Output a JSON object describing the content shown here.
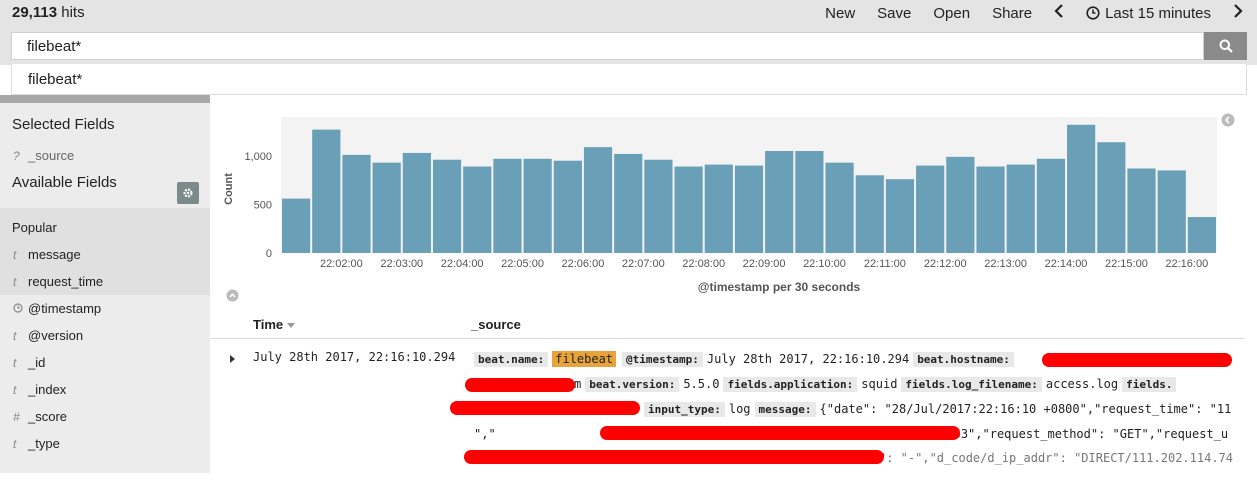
{
  "topbar": {
    "hits_count": "29,113",
    "hits_label": "hits",
    "menu": [
      "New",
      "Save",
      "Open",
      "Share"
    ],
    "time_range": "Last 15 minutes"
  },
  "search": {
    "query": "filebeat*",
    "suggestion": "filebeat*"
  },
  "sidebar": {
    "selected_title": "Selected Fields",
    "selected_fields": [
      {
        "type": "?",
        "name": "_source"
      }
    ],
    "available_title": "Available Fields",
    "popular_label": "Popular",
    "popular_fields": [
      {
        "type": "t",
        "name": "message"
      },
      {
        "type": "t",
        "name": "request_time"
      }
    ],
    "other_fields": [
      {
        "type": "clock",
        "name": "@timestamp"
      },
      {
        "type": "t",
        "name": "@version"
      },
      {
        "type": "t",
        "name": "_id"
      },
      {
        "type": "t",
        "name": "_index"
      },
      {
        "type": "#",
        "name": "_score"
      },
      {
        "type": "t",
        "name": "_type"
      }
    ]
  },
  "chart_data": {
    "type": "bar",
    "title": "",
    "xlabel": "@timestamp per 30 seconds",
    "ylabel": "Count",
    "ylim": [
      0,
      1400
    ],
    "yticks": [
      "0",
      "500",
      "1,000"
    ],
    "ytick_values": [
      0,
      500,
      1000
    ],
    "x_tick_labels": [
      "22:02:00",
      "22:03:00",
      "22:04:00",
      "22:05:00",
      "22:06:00",
      "22:07:00",
      "22:08:00",
      "22:09:00",
      "22:10:00",
      "22:11:00",
      "22:12:00",
      "22:13:00",
      "22:14:00",
      "22:15:00",
      "22:16:00"
    ],
    "values": [
      560,
      1270,
      1010,
      930,
      1030,
      960,
      890,
      970,
      970,
      950,
      1090,
      1020,
      960,
      890,
      910,
      900,
      1050,
      1050,
      930,
      800,
      760,
      900,
      990,
      890,
      910,
      970,
      1320,
      1140,
      870,
      850,
      370
    ],
    "color": "#6a9fb8"
  },
  "table": {
    "col_time": "Time",
    "col_source": "_source",
    "row_time": "July 28th 2017, 22:16:10.294",
    "source": {
      "beat_name_key": "beat.name:",
      "beat_name_val": "filebeat",
      "timestamp_key": "@timestamp:",
      "timestamp_val": "July 28th 2017, 22:16:10.294",
      "hostname_key": "beat.hostname:",
      "line2_tail": "m",
      "version_key": "beat.version:",
      "version_val": "5.5.0",
      "app_key": "fields.application:",
      "app_val": "squid",
      "logfile_key": "fields.log_filename:",
      "logfile_val": "access.log",
      "fields_key": "fields.",
      "input_key": "input_type:",
      "input_val": "log",
      "message_key": "message:",
      "message_val": "{\"date\": \"28/Jul/2017:22:16:10 +0800\",\"request_time\": \"11",
      "line4_start": "\",\"",
      "line4_end": "\",\"size\": \"1153\",\"request_method\": \"GET\",\"request_u",
      "line5_end": "\": \"-\",\"d_code/d_ip_addr\": \"DIRECT/111.202.114.74"
    }
  }
}
